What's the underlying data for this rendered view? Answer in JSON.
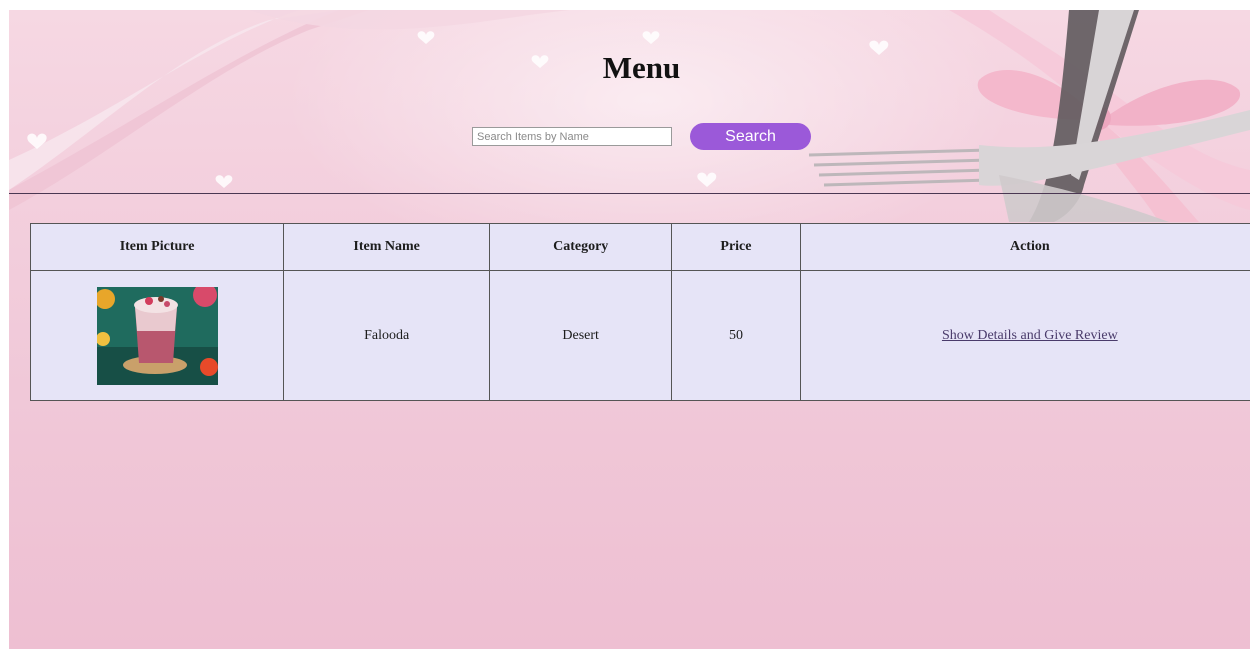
{
  "header": {
    "title": "Menu",
    "search_placeholder": "Search Items by Name",
    "search_value": "",
    "search_button_label": "Search"
  },
  "table": {
    "columns": [
      "Item Picture",
      "Item Name",
      "Category",
      "Price",
      "Action"
    ],
    "rows": [
      {
        "picture_icon": "falooda-drink-image",
        "name": "Falooda",
        "category": "Desert",
        "price": "50",
        "action_label": "Show Details and Give Review"
      }
    ]
  },
  "colors": {
    "accent_button": "#9b59d9",
    "table_background": "#e6e4f7",
    "page_background": "#f3cfdd"
  }
}
